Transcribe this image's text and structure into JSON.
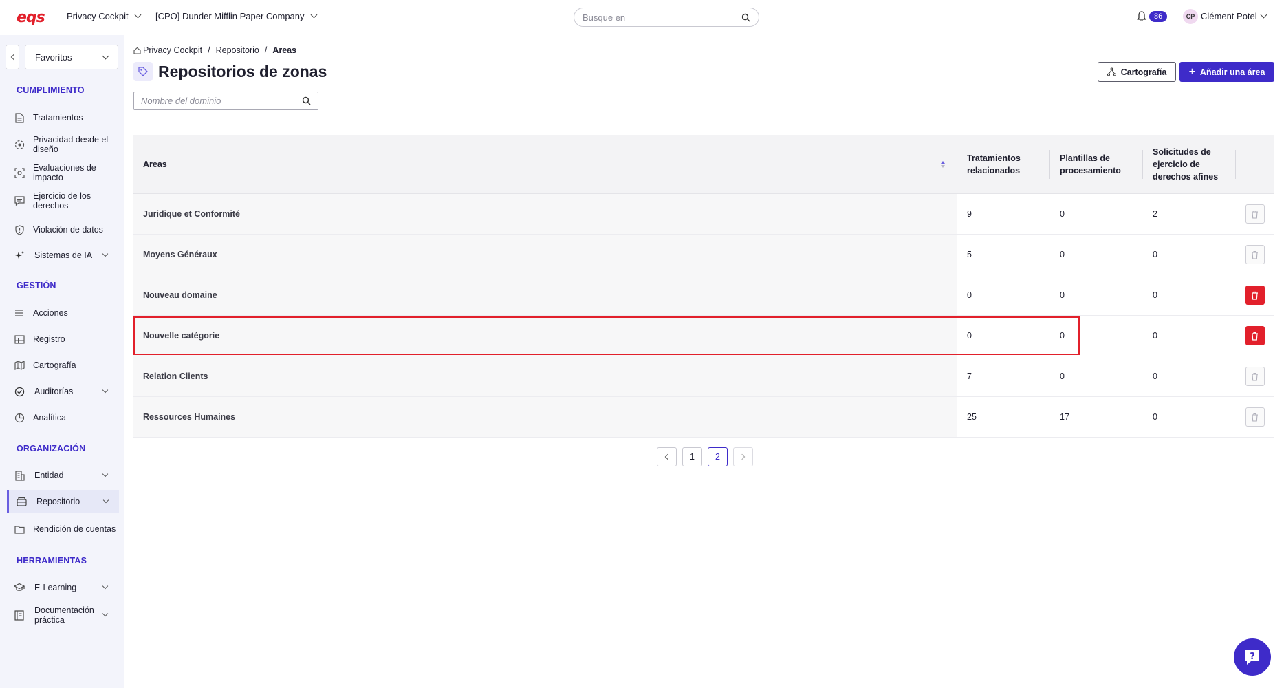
{
  "header": {
    "logo": "eqs",
    "app_menu": "Privacy Cockpit",
    "company_menu": "[CPO] Dunder Mifflin Paper Company",
    "search_placeholder": "Busque en",
    "notifications_count": "86",
    "user_initials": "CP",
    "user_name": "Clément Potel"
  },
  "sidebar": {
    "favorites": "Favoritos",
    "sections": {
      "cumplimiento": "CUMPLIMIENTO",
      "gestion": "GESTIÓN",
      "organizacion": "ORGANIZACIÓN",
      "herramientas": "HERRAMIENTAS"
    },
    "items": {
      "tratamientos": "Tratamientos",
      "privacidad": "Privacidad desde el diseño",
      "evaluaciones": "Evaluaciones de impacto",
      "ejercicio": "Ejercicio de los derechos",
      "violacion": "Violación de datos",
      "sistemas_ia": "Sistemas de IA",
      "acciones": "Acciones",
      "registro": "Registro",
      "cartografia": "Cartografía",
      "auditorias": "Auditorías",
      "analitica": "Analítica",
      "entidad": "Entidad",
      "repositorio": "Repositorio",
      "rendicion": "Rendición de cuentas",
      "elearning": "E-Learning",
      "documentacion": "Documentación práctica"
    }
  },
  "breadcrumb": {
    "home": "Privacy Cockpit",
    "repo": "Repositorio",
    "current": "Areas"
  },
  "page": {
    "title": "Repositorios de zonas",
    "btn_map": "Cartografía",
    "btn_add": "Añadir una área",
    "domain_search_placeholder": "Nombre del dominio"
  },
  "table": {
    "headers": {
      "area": "Areas",
      "tratamientos": "Tratamientos relacionados",
      "plantillas": "Plantillas de procesamiento",
      "solicitudes": "Solicitudes de ejercicio de derechos afines"
    },
    "rows": [
      {
        "area": "Juridique et Conformité",
        "tratamientos": "9",
        "plantillas": "0",
        "solicitudes": "2",
        "deletable": false
      },
      {
        "area": "Moyens Généraux",
        "tratamientos": "5",
        "plantillas": "0",
        "solicitudes": "0",
        "deletable": false
      },
      {
        "area": "Nouveau domaine",
        "tratamientos": "0",
        "plantillas": "0",
        "solicitudes": "0",
        "deletable": true
      },
      {
        "area": "Nouvelle catégorie",
        "tratamientos": "0",
        "plantillas": "0",
        "solicitudes": "0",
        "deletable": true
      },
      {
        "area": "Relation Clients",
        "tratamientos": "7",
        "plantillas": "0",
        "solicitudes": "0",
        "deletable": false
      },
      {
        "area": "Ressources Humaines",
        "tratamientos": "25",
        "plantillas": "17",
        "solicitudes": "0",
        "deletable": false
      }
    ]
  },
  "pagination": {
    "pages": [
      "1",
      "2"
    ],
    "current": "2"
  },
  "colors": {
    "accent": "#3e2bc9",
    "danger": "#e2202b"
  }
}
